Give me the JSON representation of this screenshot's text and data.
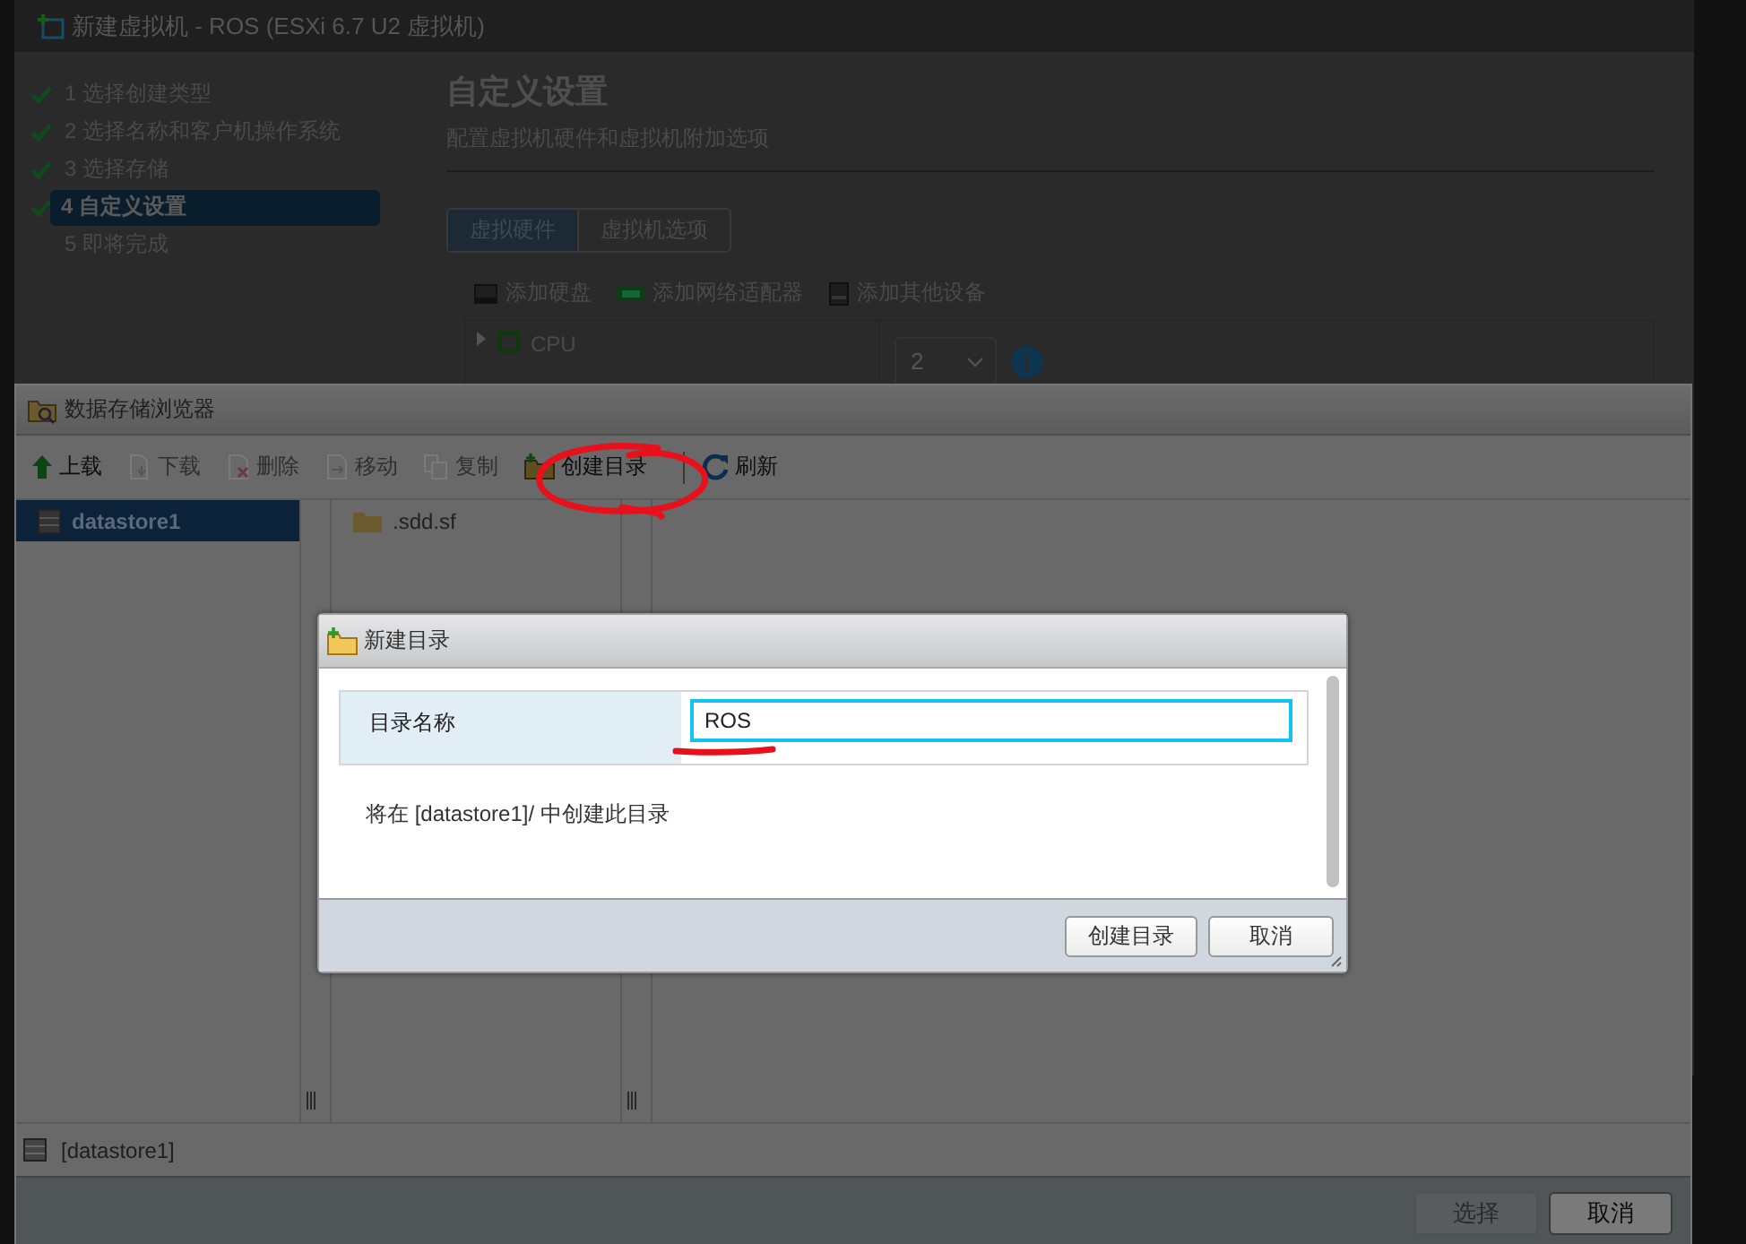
{
  "wizard": {
    "title": "新建虚拟机 - ROS (ESXi 6.7 U2 虚拟机)",
    "steps": [
      {
        "label": "1 选择创建类型",
        "done": true,
        "selected": false
      },
      {
        "label": "2 选择名称和客户机操作系统",
        "done": true,
        "selected": false
      },
      {
        "label": "3 选择存储",
        "done": true,
        "selected": false
      },
      {
        "label": "4 自定义设置",
        "done": true,
        "selected": true
      },
      {
        "label": "5 即将完成",
        "done": false,
        "selected": false
      }
    ],
    "heading": "自定义设置",
    "subheading": "配置虚拟机硬件和虚拟机附加选项",
    "tabs": [
      {
        "label": "虚拟硬件",
        "selected": true
      },
      {
        "label": "虚拟机选项",
        "selected": false
      }
    ],
    "actions": [
      {
        "label": "添加硬盘",
        "kind": "disk"
      },
      {
        "label": "添加网络适配器",
        "kind": "network"
      },
      {
        "label": "添加其他设备",
        "kind": "device"
      }
    ],
    "hardware": [
      {
        "name": "CPU",
        "value": "2"
      }
    ]
  },
  "browser": {
    "title": "数据存储浏览器",
    "toolbar": [
      {
        "label": "上载",
        "kind": "upload",
        "disabled": false
      },
      {
        "label": "下载",
        "kind": "download",
        "disabled": true
      },
      {
        "label": "删除",
        "kind": "delete",
        "disabled": true
      },
      {
        "label": "移动",
        "kind": "move",
        "disabled": true
      },
      {
        "label": "复制",
        "kind": "copy",
        "disabled": true
      },
      {
        "label": "创建目录",
        "kind": "new-folder",
        "disabled": false
      },
      {
        "label": "刷新",
        "kind": "refresh",
        "disabled": false
      }
    ],
    "datastores": [
      {
        "label": "datastore1",
        "selected": true
      }
    ],
    "files": [
      {
        "name": ".sdd.sf"
      }
    ],
    "status": "[datastore1]",
    "buttons": [
      {
        "label": "选择",
        "disabled": true
      },
      {
        "label": "取消",
        "disabled": false
      }
    ]
  },
  "dialog": {
    "title": "新建目录",
    "field_label": "目录名称",
    "field_value": "ROS",
    "note": "将在 [datastore1]/ 中创建此目录",
    "buttons": [
      {
        "label": "创建目录"
      },
      {
        "label": "取消"
      }
    ]
  }
}
